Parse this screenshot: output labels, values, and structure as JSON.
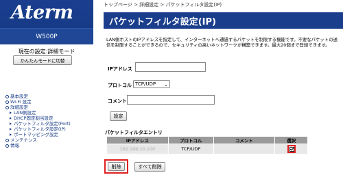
{
  "sidebar": {
    "logo": "Aterm",
    "model": "W500P",
    "mode_text": "現在の設定:詳細モード",
    "easy_mode_button": "かんたんモードに切替",
    "nav": [
      {
        "label": "基本設定",
        "level": 0
      },
      {
        "label": "Wi-Fi 設定",
        "level": 0
      },
      {
        "label": "詳細設定",
        "level": 0
      },
      {
        "label": "LAN側設定",
        "level": 1
      },
      {
        "label": "DHCP固定割当設定",
        "level": 1
      },
      {
        "label": "パケットフィルタ設定(Port)",
        "level": 1
      },
      {
        "label": "パケットフィルタ設定(IP)",
        "level": 1
      },
      {
        "label": "ポートマッピング設定",
        "level": 1
      },
      {
        "label": "メンテナンス",
        "level": 0
      },
      {
        "label": "情報",
        "level": 0
      }
    ]
  },
  "breadcrumb": "トップページ > 詳細設定 > パケットフィルタ設定(IP)",
  "page_title": "パケットフィルタ設定(IP)",
  "description": "LAN側ホストのIPアドレスを指定して、インターネットへ通過するパケットを制限する機能です。不要なパケットの送信を制限することができるので、セキュリティの高いネットワークが構築できます。最大20個まで登録できます。",
  "form": {
    "ip_label": "IPアドレス",
    "ip_value": "",
    "protocol_label": "プロトコル",
    "protocol_value": "TCP/UDP",
    "comment_label": "コメント",
    "comment_value": "",
    "set_button": "設定"
  },
  "entries": {
    "title": "パケットフィルタエントリ",
    "headers": [
      "IPアドレス",
      "プロトコル",
      "コメント",
      "選択"
    ],
    "rows": [
      {
        "ip": "192.168.10.100",
        "protocol": "TCP/UDP",
        "comment": "",
        "selected": true
      }
    ]
  },
  "buttons": {
    "delete": "削除",
    "delete_all": "すべて削除"
  },
  "colors": {
    "brand_blue": "#1a3e8c",
    "highlight_red": "#e02020"
  }
}
